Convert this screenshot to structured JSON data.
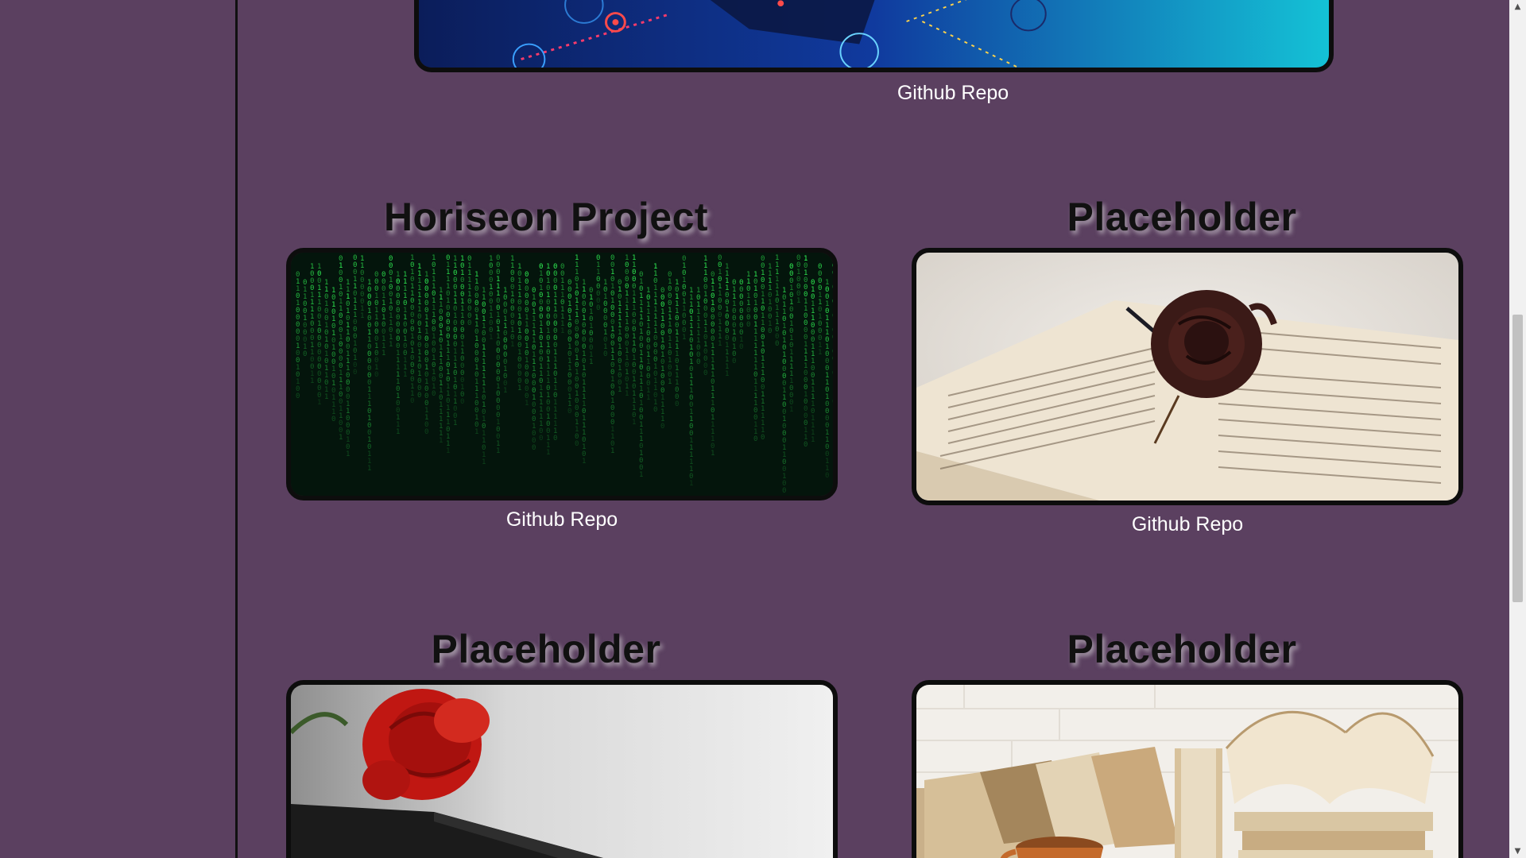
{
  "projects": [
    {
      "title": "",
      "link_label": "Github Repo",
      "image": "tech-network-image"
    },
    {
      "title": "Horiseon Project",
      "link_label": "Github Repo",
      "image": "matrix-code-image"
    },
    {
      "title": "Placeholder",
      "link_label": "Github Repo",
      "image": "dried-rose-on-book-image"
    },
    {
      "title": "Placeholder",
      "link_label": "",
      "image": "red-rose-on-book-image"
    },
    {
      "title": "Placeholder",
      "link_label": "",
      "image": "books-and-coffee-image"
    }
  ],
  "scrollbar": {
    "up_icon": "arrow-up-icon",
    "down_icon": "arrow-down-icon"
  }
}
